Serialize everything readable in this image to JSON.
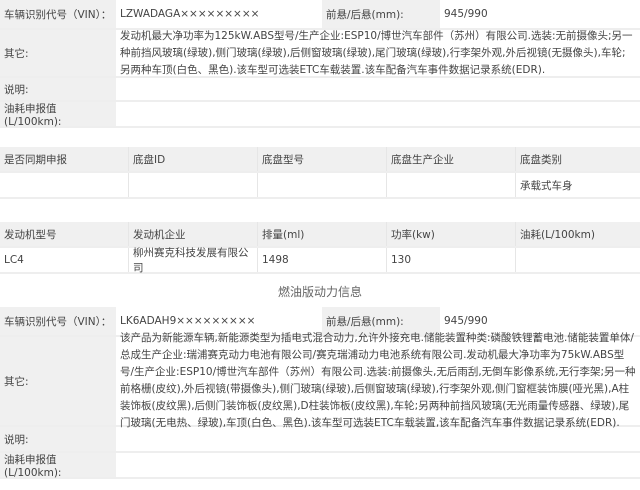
{
  "block1": {
    "vin_label": "车辆识别代号（VIN）：",
    "vin": "LZWADAGA×××××××××",
    "overhang_label": "前悬/后悬(mm):",
    "overhang": "945/990",
    "other_label": "其它:",
    "other": "发动机最大净功率为125kW.ABS型号/生产企业:ESP10/博世汽车部件（苏州）有限公司.选装:无前摄像头;另一种前挡风玻璃(绿玻),侧门玻璃(绿玻),后侧窗玻璃(绿玻),尾门玻璃(绿玻),行李架外观,外后视镜(无摄像头),车轮;另两种车顶(白色、黑色).该车型可选装ETC车载装置.该车配备汽车事件数据记录系统(EDR).",
    "note_label": "说明:",
    "fuel_label": "油耗申报值(L/100km):"
  },
  "chassis": {
    "headers": [
      "是否同期申报",
      "底盘ID",
      "底盘型号",
      "底盘生产企业",
      "底盘类别"
    ],
    "row": [
      "",
      "",
      "",
      "",
      "承载式车身"
    ]
  },
  "engine": {
    "headers": [
      "发动机型号",
      "发动机企业",
      "排量(ml)",
      "功率(kw)",
      "油耗(L/100km)"
    ],
    "row": [
      "LC4",
      "柳州赛克科技发展有限公司",
      "1498",
      "130",
      ""
    ]
  },
  "section_title": "燃油版动力信息",
  "block2": {
    "vin_label": "车辆识别代号（VIN）：",
    "vin": "LK6ADAH9×××××××××",
    "overhang_label": "前悬/后悬(mm):",
    "overhang": "945/990",
    "other_label": "其它:",
    "other": "该产品为新能源车辆,新能源类型为插电式混合动力,允许外接充电.储能装置种类:磷酸铁锂蓄电池.储能装置单体/总成生产企业:瑞浦赛克动力电池有限公司/赛克瑞浦动力电池系统有限公司.发动机最大净功率为75kW.ABS型号/生产企业:ESP10/博世汽车部件（苏州）有限公司.选装:前摄像头,无后雨刮,无倒车影像系统,无行李架;另一种前格栅(皮纹),外后视镜(带摄像头),侧门玻璃(绿玻),后侧窗玻璃(绿玻),行李架外观,侧门窗框装饰膜(哑光黑),A柱装饰板(皮纹黑),后侧门装饰板(皮纹黑),D柱装饰板(皮纹黑),车轮;另两种前挡风玻璃(无光雨量传感器、绿玻),尾门玻璃(无电热、绿玻),车顶(白色、黑色).该车型可选装ETC车载装置,该车配备汽车事件数据记录系统(EDR).",
    "note_label": "说明:",
    "fuel_label": "油耗申报值(L/100km):"
  }
}
